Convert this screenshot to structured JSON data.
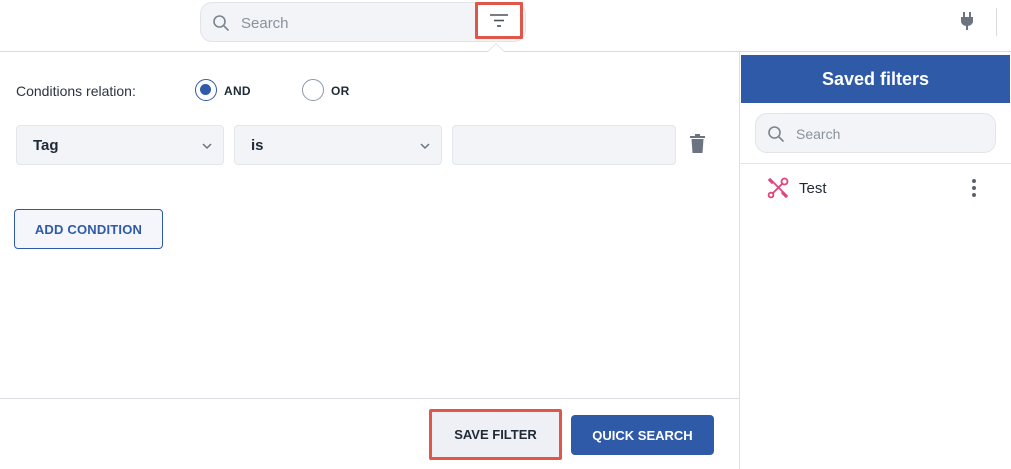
{
  "topbar": {
    "search_placeholder": "Search",
    "icons": [
      "search-icon",
      "filter-icon",
      "plug-icon"
    ]
  },
  "filter_panel": {
    "conditions_relation_label": "Conditions relation:",
    "relation_options": [
      {
        "label": "AND",
        "selected": true
      },
      {
        "label": "OR",
        "selected": false
      }
    ],
    "condition": {
      "field": "Tag",
      "operator": "is",
      "value": ""
    },
    "add_condition_label": "ADD CONDITION",
    "save_filter_label": "SAVE FILTER",
    "quick_search_label": "QUICK SEARCH"
  },
  "saved_filters": {
    "title": "Saved filters",
    "search_placeholder": "Search",
    "items": [
      {
        "label": "Test",
        "icon": "tools-icon"
      }
    ]
  },
  "colors": {
    "primary": "#2f5aa7",
    "highlight": "#e0574a",
    "item_icon": "#e0457b"
  }
}
